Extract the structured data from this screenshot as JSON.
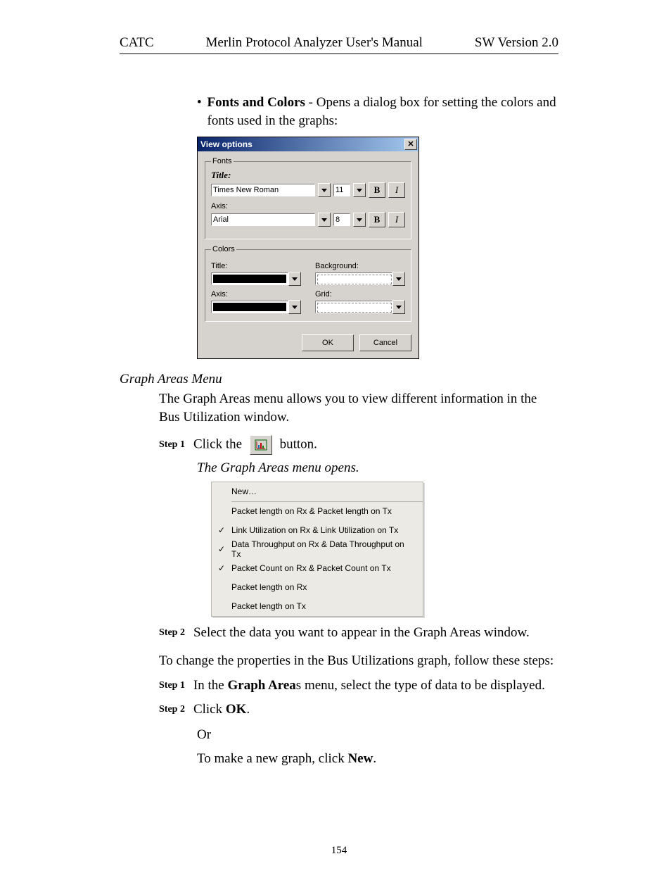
{
  "header": {
    "left": "CATC",
    "center": "Merlin Protocol Analyzer User's Manual",
    "right": "SW Version 2.0"
  },
  "bullet": {
    "bold": "Fonts and Colors",
    "rest": " - Opens a dialog box for setting the colors and fonts used in the graphs:"
  },
  "dialog": {
    "title": "View options",
    "fonts_legend": "Fonts",
    "title_label": "Title:",
    "title_font": "Times New Roman",
    "title_size": "11",
    "axis_label": "Axis:",
    "axis_font": "Arial",
    "axis_size": "8",
    "bold_btn": "B",
    "italic_btn": "I",
    "colors_legend": "Colors",
    "c_title": "Title:",
    "c_background": "Background:",
    "c_axis": "Axis:",
    "c_grid": "Grid:",
    "ok": "OK",
    "cancel": "Cancel"
  },
  "section_heading": "Graph Areas Menu",
  "para1": "The Graph Areas menu allows you to view different information in the Bus Utilization window.",
  "steps1": {
    "s1_label": "Step 1",
    "s1_a": "Click the",
    "s1_b": "button."
  },
  "italic_line": "The Graph Areas menu opens.",
  "menu": {
    "new": "New…",
    "items": [
      {
        "checked": false,
        "label": "Packet length on Rx & Packet length on Tx"
      },
      {
        "checked": true,
        "label": "Link Utilization on Rx & Link Utilization on Tx"
      },
      {
        "checked": true,
        "label": "Data Throughput on Rx & Data Throughput on Tx"
      },
      {
        "checked": true,
        "label": "Packet Count on Rx & Packet Count on Tx"
      },
      {
        "checked": false,
        "label": "Packet length on Rx"
      },
      {
        "checked": false,
        "label": "Packet length on Tx"
      }
    ]
  },
  "steps2": {
    "s2_label": "Step 2",
    "s2_text": "Select the data you want to appear in the Graph Areas window."
  },
  "para2": "To change the properties in the Bus Utilizations graph, follow these steps:",
  "steps3": {
    "s1_label": "Step 1",
    "s1_a": "In the ",
    "s1_bold": "Graph Area",
    "s1_b": "s menu, select the type of data to be displayed.",
    "s2_label": "Step 2",
    "s2_a": "Click ",
    "s2_bold": "OK",
    "s2_b": "."
  },
  "or_line": "Or",
  "last_a": "To make a new graph, click ",
  "last_bold": "New",
  "last_b": ".",
  "page_number": "154"
}
